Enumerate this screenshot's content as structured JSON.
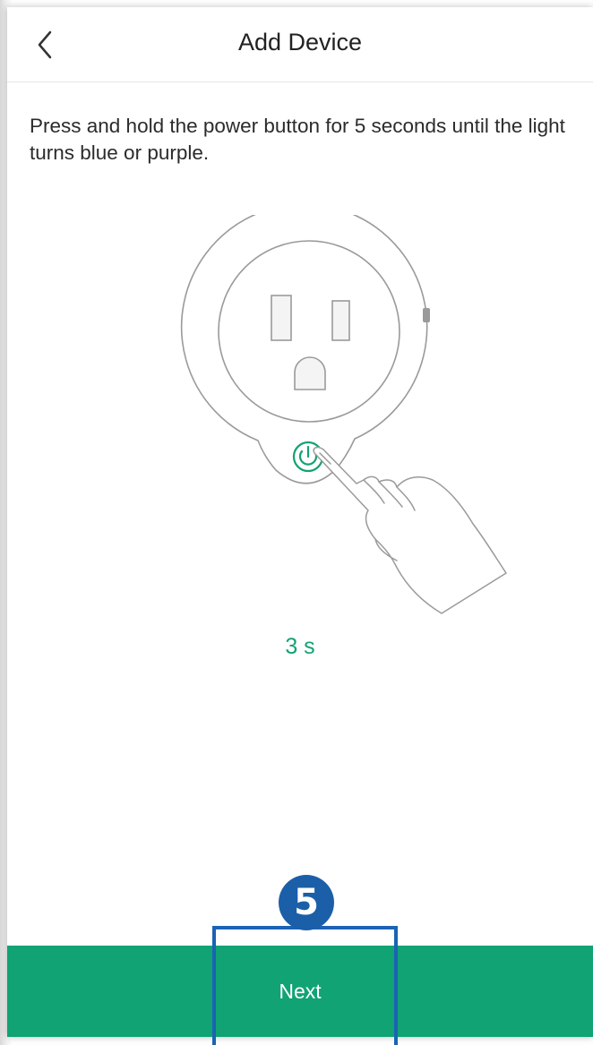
{
  "header": {
    "title": "Add Device"
  },
  "main": {
    "instruction": "Press and hold the power button for 5 seconds until the light turns blue or purple.",
    "countdown": "3 s"
  },
  "footer": {
    "next_label": "Next"
  },
  "annotation": {
    "step_number": "5"
  },
  "colors": {
    "accent_green": "#11a373",
    "annotation_blue": "#1b63b4"
  },
  "icons": [
    "chevron-left-icon",
    "smart-plug-illustration",
    "power-icon",
    "pointing-hand-icon"
  ]
}
